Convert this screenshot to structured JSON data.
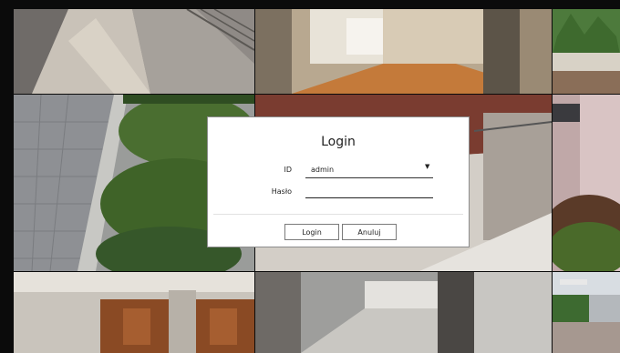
{
  "login_dialog": {
    "title": "Login",
    "id_label": "ID",
    "id_value": "admin",
    "password_label": "Hasło",
    "password_value": "",
    "login_button": "Login",
    "cancel_button": "Anuluj"
  },
  "camera_grid": {
    "cameras": [
      "camera-1",
      "camera-2",
      "camera-3",
      "camera-4",
      "camera-5",
      "camera-6",
      "camera-7",
      "camera-8",
      "camera-9"
    ]
  },
  "colors": {
    "dialog_bg": "#ffffff",
    "dialog_border": "#8c8c8c",
    "background": "#0b0b0b"
  },
  "icons": {
    "dropdown": "chevron-down-icon"
  }
}
